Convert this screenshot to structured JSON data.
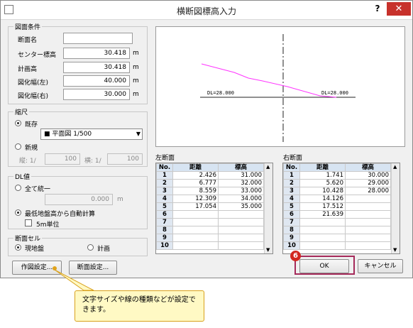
{
  "window": {
    "title": "横断図標高入力",
    "help": "?",
    "close": "✕"
  },
  "conditions": {
    "legend": "図面条件",
    "section_name_label": "断面名",
    "section_name_value": "",
    "center_elev_label": "センター標高",
    "center_elev_value": "30.418",
    "center_elev_unit": "m",
    "plan_elev_label": "計画高",
    "plan_elev_value": "30.418",
    "plan_elev_unit": "m",
    "width_left_label": "図化幅(左)",
    "width_left_value": "40.000",
    "width_left_unit": "m",
    "width_right_label": "図化幅(右)",
    "width_right_value": "30.000",
    "width_right_unit": "m"
  },
  "scale": {
    "legend": "縮尺",
    "existing_label": "既存",
    "combo_value": "■ 平面図 1/500",
    "new_label": "新規",
    "vert_label": "縦: 1/",
    "vert_value": "100",
    "horiz_label": "横: 1/",
    "horiz_value": "100"
  },
  "dl": {
    "legend": "DL値",
    "unify_label": "全て統一",
    "unify_value": "0.000",
    "unify_unit": "m",
    "auto_label": "最低地盤高から自動計算",
    "m5_label": "5m単位"
  },
  "cell": {
    "legend": "断面セル",
    "ground_label": "現地盤",
    "plan_label": "計画"
  },
  "preview": {
    "dl_left": "DL=28.000",
    "dl_right": "DL=28.000",
    "line_color": "#ff33ff"
  },
  "left_section": {
    "title": "左断面",
    "headers": [
      "No.",
      "距離",
      "標高"
    ],
    "rows": [
      [
        "1",
        "2.426",
        "31.000"
      ],
      [
        "2",
        "6.777",
        "32.000"
      ],
      [
        "3",
        "8.559",
        "33.000"
      ],
      [
        "4",
        "12.309",
        "34.000"
      ],
      [
        "5",
        "17.054",
        "35.000"
      ],
      [
        "6",
        "",
        ""
      ],
      [
        "7",
        "",
        ""
      ],
      [
        "8",
        "",
        ""
      ],
      [
        "9",
        "",
        ""
      ],
      [
        "10",
        "",
        ""
      ]
    ]
  },
  "right_section": {
    "title": "右断面",
    "headers": [
      "No.",
      "距離",
      "標高"
    ],
    "rows": [
      [
        "1",
        "1.741",
        "30.000"
      ],
      [
        "2",
        "5.620",
        "29.000"
      ],
      [
        "3",
        "10.428",
        "28.000"
      ],
      [
        "4",
        "14.126",
        ""
      ],
      [
        "5",
        "17.512",
        ""
      ],
      [
        "6",
        "21.639",
        ""
      ],
      [
        "7",
        "",
        ""
      ],
      [
        "8",
        "",
        ""
      ],
      [
        "9",
        "",
        ""
      ],
      [
        "10",
        "",
        ""
      ]
    ]
  },
  "buttons": {
    "draw_settings": "作図設定...",
    "section_settings": "断面設定...",
    "ok": "OK",
    "cancel": "キャンセル"
  },
  "markers": {
    "step": "6"
  },
  "callout": {
    "text": "文字サイズや線の種類などが設定できます。"
  },
  "colors": {
    "accent": "#a52a5a",
    "callout_border": "#d9a11c",
    "step_badge": "#d2281e"
  }
}
